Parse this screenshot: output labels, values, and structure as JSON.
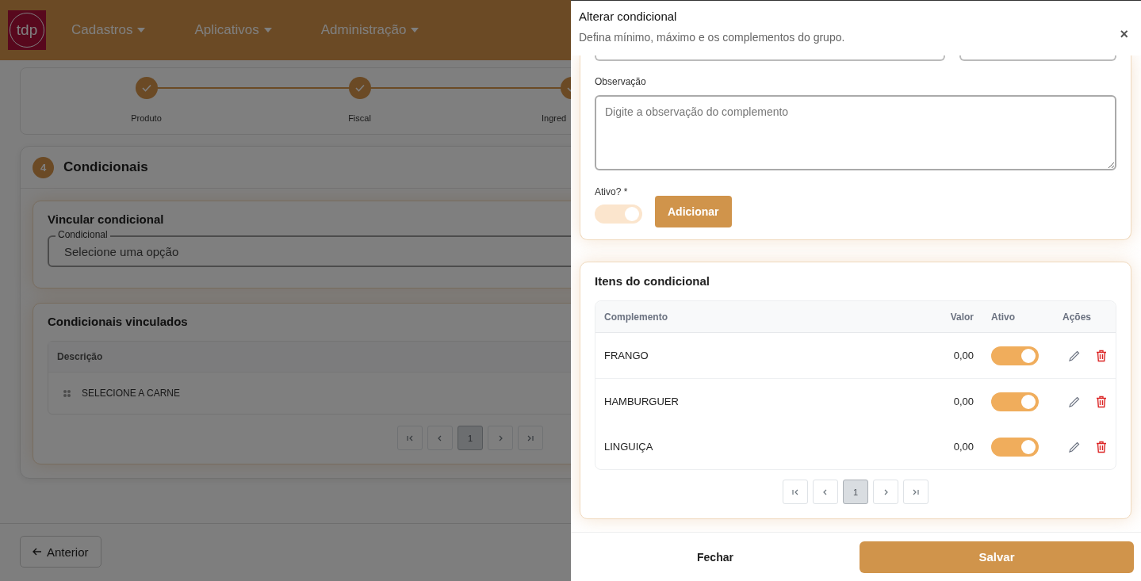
{
  "navbar": {
    "logo_text": "tdp",
    "menus": [
      {
        "label": "Cadastros"
      },
      {
        "label": "Aplicativos"
      },
      {
        "label": "Administração"
      }
    ]
  },
  "stepper": [
    {
      "label": "Produto",
      "done": true
    },
    {
      "label": "Fiscal",
      "done": true
    },
    {
      "label": "Ingred",
      "done": true
    }
  ],
  "section": {
    "number": "4",
    "title": "Condicionais"
  },
  "link_card": {
    "title": "Vincular condicional",
    "select": {
      "label": "Condicional",
      "placeholder": "Selecione uma opção"
    }
  },
  "linked_card": {
    "title": "Condicionais vinculados",
    "columns": [
      "Descrição"
    ],
    "rows": [
      {
        "description": "SELECIONE A CARNE"
      }
    ],
    "pages": [
      {
        "label": "1",
        "selected": true
      }
    ]
  },
  "back_button": "Anterior",
  "drawer": {
    "title": "Alterar condicional",
    "subtitle": "Defina mínimo, máximo e os complementos do grupo.",
    "close": "×",
    "form": {
      "note_label": "Observação",
      "note_placeholder": "Digite a observação do complemento",
      "active_label": "Ativo? *",
      "active_on": true,
      "add_button": "Adicionar"
    },
    "items": {
      "title": "Itens do condicional",
      "columns": [
        "Complemento",
        "Valor",
        "Ativo",
        "Ações"
      ],
      "rows": [
        {
          "name": "FRANGO",
          "value": "0,00",
          "active": true
        },
        {
          "name": "HAMBURGUER",
          "value": "0,00",
          "active": true
        },
        {
          "name": "LINGUIÇA",
          "value": "0,00",
          "active": true
        }
      ],
      "pages": [
        {
          "label": "1",
          "selected": true
        }
      ]
    },
    "footer": {
      "close_button": "Fechar",
      "save_button": "Salvar"
    }
  }
}
